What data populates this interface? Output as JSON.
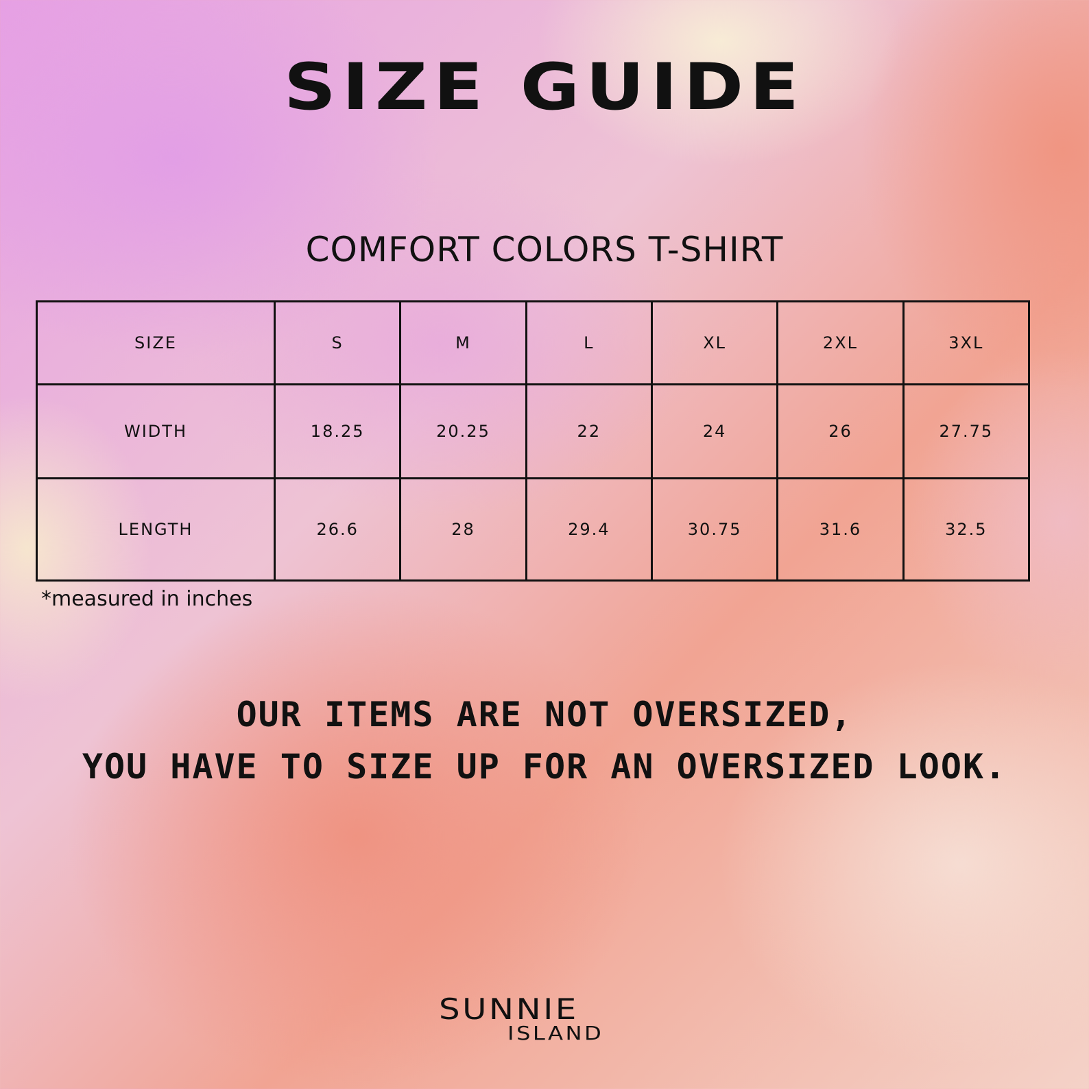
{
  "title": "SIZE GUIDE",
  "subtitle": "COMFORT COLORS T-SHIRT",
  "table": {
    "headers": [
      "SIZE",
      "S",
      "M",
      "L",
      "XL",
      "2XL",
      "3XL"
    ],
    "rows": [
      [
        "WIDTH",
        "18.25",
        "20.25",
        "22",
        "24",
        "26",
        "27.75"
      ],
      [
        "LENGTH",
        "26.6",
        "28",
        "29.4",
        "30.75",
        "31.6",
        "32.5"
      ]
    ]
  },
  "note": "*measured in inches",
  "message": {
    "line1": "OUR ITEMS ARE NOT OVERSIZED,",
    "line2": "YOU HAVE TO SIZE UP FOR AN OVERSIZED LOOK."
  },
  "logo": {
    "top": "SUNNIE",
    "bottom": "ISLAND"
  },
  "colors": {
    "text": "#111111",
    "background_pink": "#e6a0e4",
    "background_peach": "#f1a493",
    "background_cream": "#f8eed6"
  }
}
